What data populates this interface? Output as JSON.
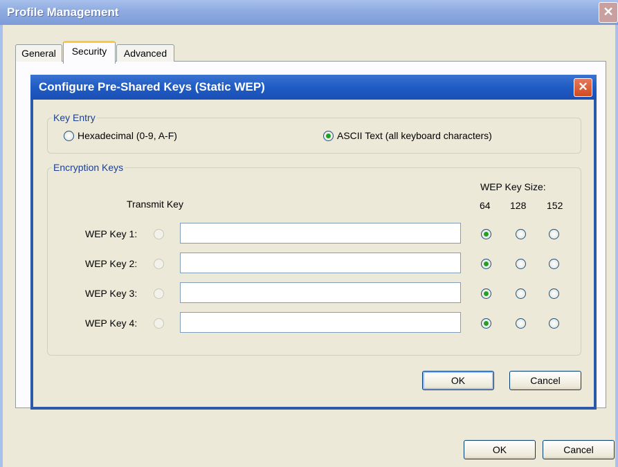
{
  "window": {
    "title": "Profile Management",
    "close_glyph": "✕"
  },
  "tabs": [
    {
      "label": "General"
    },
    {
      "label": "Security"
    },
    {
      "label": "Advanced"
    }
  ],
  "dialog": {
    "title": "Configure Pre-Shared Keys (Static WEP)",
    "close_glyph": "✕",
    "key_entry": {
      "legend": "Key Entry",
      "options": [
        {
          "label": "Hexadecimal (0-9, A-F)",
          "selected": false
        },
        {
          "label": "ASCII Text (all keyboard characters)",
          "selected": true
        }
      ]
    },
    "encryption_keys": {
      "legend": "Encryption Keys",
      "transmit_key_label": "Transmit Key",
      "wep_key_size_label": "WEP Key Size:",
      "sizes": [
        "64",
        "128",
        "152"
      ],
      "keys": [
        {
          "label": "WEP Key 1:",
          "value": "",
          "size": "64"
        },
        {
          "label": "WEP Key 2:",
          "value": "",
          "size": "64"
        },
        {
          "label": "WEP Key 3:",
          "value": "",
          "size": "64"
        },
        {
          "label": "WEP Key 4:",
          "value": "",
          "size": "64"
        }
      ]
    },
    "ok_label": "OK",
    "cancel_label": "Cancel"
  },
  "footer": {
    "ok_label": "OK",
    "cancel_label": "Cancel"
  }
}
